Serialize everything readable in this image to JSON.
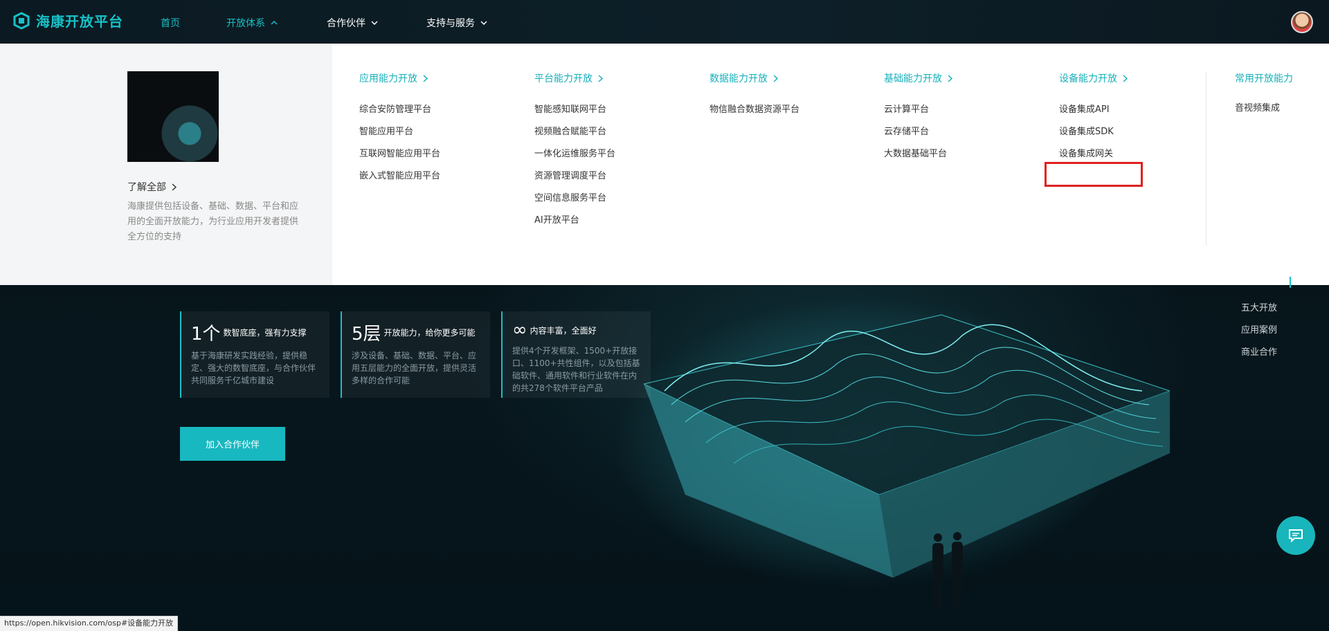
{
  "nav": {
    "logo": "海康开放平台",
    "home": "首页",
    "open_system": "开放体系",
    "partners": "合作伙伴",
    "support": "支持与服务"
  },
  "dropdown": {
    "learn_all": "了解全部",
    "description": "海康提供包括设备、基础、数据、平台和应用的全面开放能力，为行业应用开发者提供全方位的支持",
    "columns": [
      {
        "title": "应用能力开放",
        "items": [
          "综合安防管理平台",
          "智能应用平台",
          "互联网智能应用平台",
          "嵌入式智能应用平台"
        ]
      },
      {
        "title": "平台能力开放",
        "items": [
          "智能感知联网平台",
          "视频融合赋能平台",
          "一体化运维服务平台",
          "资源管理调度平台",
          "空间信息服务平台",
          "AI开放平台"
        ]
      },
      {
        "title": "数据能力开放",
        "items": [
          "物信融合数据资源平台"
        ]
      },
      {
        "title": "基础能力开放",
        "items": [
          "云计算平台",
          "云存储平台",
          "大数据基础平台"
        ]
      },
      {
        "title": "设备能力开放",
        "items": [
          "设备集成API",
          "设备集成SDK",
          "设备集成网关"
        ]
      }
    ],
    "common": {
      "title": "常用开放能力",
      "items": [
        "音视频集成"
      ]
    }
  },
  "stats": [
    {
      "big": "1个",
      "title": "数智底座，强有力支撑",
      "body": "基于海康研发实践经验，提供稳定、强大的数智底座，与合作伙伴共同服务千亿城市建设"
    },
    {
      "big": "5层",
      "title": "开放能力，给你更多可能",
      "body": "涉及设备、基础、数据、平台、应用五层能力的全面开放，提供灵活多样的合作可能"
    },
    {
      "big": "∞",
      "title": "内容丰富，全面好",
      "body": "提供4个开发框架、1500+开放接口、1100+共性组件，以及包括基础软件、通用软件和行业软件在内的共278个软件平台产品"
    }
  ],
  "join_button": "加入合作伙伴",
  "side_nav": [
    "五大开放",
    "应用案例",
    "商业合作"
  ],
  "status_url": "https://open.hikvision.com/osp#设备能力开放",
  "colors": {
    "accent": "#17c1c7",
    "highlight": "#e02020"
  }
}
